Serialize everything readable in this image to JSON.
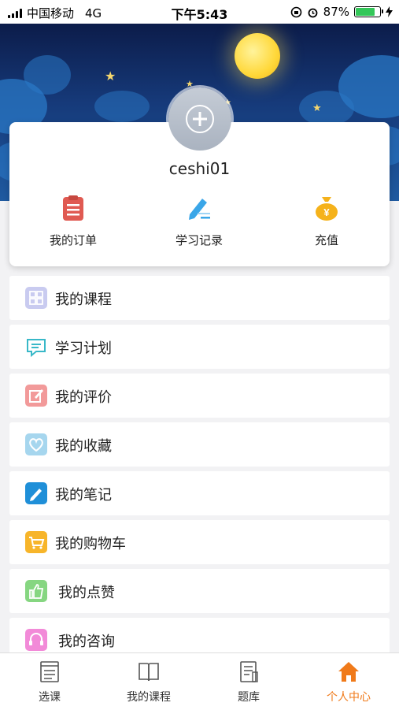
{
  "status_bar": {
    "carrier": "中国移动",
    "network": "4G",
    "time": "下午5:43",
    "battery": "87%",
    "battery_level": 0.87
  },
  "profile": {
    "username": "ceshi01"
  },
  "quick_actions": [
    {
      "label": "我的订单",
      "icon": "clipboard-icon",
      "color": "#e05a52"
    },
    {
      "label": "学习记录",
      "icon": "pen-write-icon",
      "color": "#3aa6e8"
    },
    {
      "label": "充值",
      "icon": "money-bag-icon",
      "color": "#f5b21b"
    }
  ],
  "menu": [
    {
      "label": "我的课程",
      "icon": "grid-icon",
      "color": "#b7b9e8"
    },
    {
      "label": "学习计划",
      "icon": "chat-bubble-icon",
      "color": "#38b8c8"
    },
    {
      "label": "我的评价",
      "icon": "edit-icon",
      "color": "#f08a8a"
    },
    {
      "label": "我的收藏",
      "icon": "heart-icon",
      "color": "#9ed0ea"
    },
    {
      "label": "我的笔记",
      "icon": "pencil-icon",
      "color": "#1f8fd8"
    },
    {
      "label": "我的购物车",
      "icon": "cart-icon",
      "color": "#f7b52a"
    },
    {
      "label": "我的点赞",
      "icon": "thumbs-up-icon",
      "color": "#7fd07a"
    },
    {
      "label": "我的咨询",
      "icon": "headset-icon",
      "color": "#f28ad8"
    }
  ],
  "tabbar": [
    {
      "label": "选课",
      "icon": "list-icon",
      "active": false
    },
    {
      "label": "我的课程",
      "icon": "book-icon",
      "active": false
    },
    {
      "label": "题库",
      "icon": "question-bank-icon",
      "active": false
    },
    {
      "label": "个人中心",
      "icon": "home-icon",
      "active": true
    }
  ],
  "accent_color": "#f07a1a"
}
